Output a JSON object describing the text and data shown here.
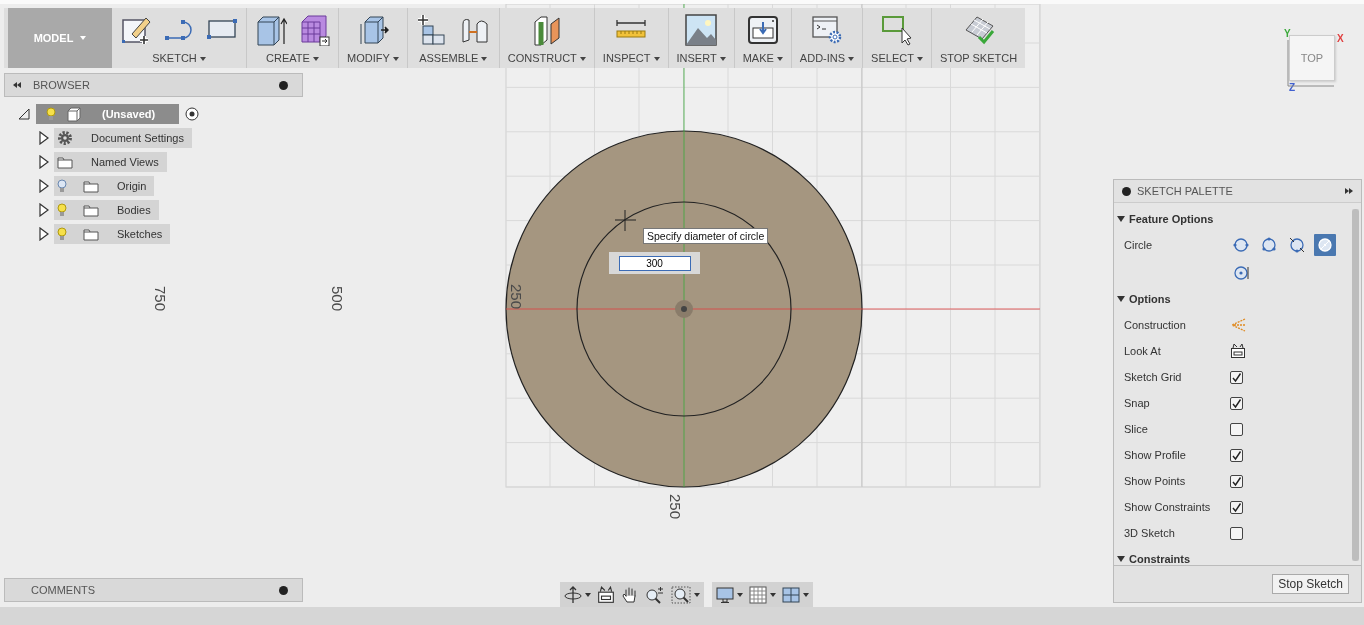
{
  "toolbar": {
    "workspace": {
      "label": "MODEL",
      "dropdown": true
    },
    "groups": [
      {
        "label": "SKETCH",
        "dropdown": true
      },
      {
        "label": "CREATE",
        "dropdown": true
      },
      {
        "label": "MODIFY",
        "dropdown": true
      },
      {
        "label": "ASSEMBLE",
        "dropdown": true
      },
      {
        "label": "CONSTRUCT",
        "dropdown": true
      },
      {
        "label": "INSPECT",
        "dropdown": true
      },
      {
        "label": "INSERT",
        "dropdown": true
      },
      {
        "label": "MAKE",
        "dropdown": true
      },
      {
        "label": "ADD-INS",
        "dropdown": true
      },
      {
        "label": "SELECT",
        "dropdown": true
      },
      {
        "label": "STOP SKETCH",
        "dropdown": false
      }
    ]
  },
  "browser": {
    "title": "BROWSER",
    "root": {
      "label": "(Unsaved)",
      "selected": true,
      "expanded": true,
      "visible": true,
      "children": [
        {
          "kind": "settings",
          "label": "Document Settings",
          "selected": false,
          "expanded": false
        },
        {
          "kind": "views",
          "label": "Named Views",
          "selected": false,
          "expanded": false
        },
        {
          "kind": "folder",
          "label": "Origin",
          "selected": false,
          "expanded": false,
          "visible": false
        },
        {
          "kind": "folder",
          "label": "Bodies",
          "selected": false,
          "expanded": false,
          "visible": true
        },
        {
          "kind": "folder",
          "label": "Sketches",
          "selected": false,
          "expanded": false,
          "visible": true
        }
      ]
    }
  },
  "comments": {
    "title": "COMMENTS"
  },
  "canvas": {
    "dimension_labels": [
      "750",
      "500",
      "250",
      "250"
    ],
    "tooltip": "Specify diameter of circle",
    "diameter_input": {
      "value": "300"
    }
  },
  "view_cube": {
    "face": "TOP",
    "axes": [
      "X",
      "Y",
      "Z"
    ]
  },
  "sketch_palette": {
    "title": "SKETCH PALETTE",
    "sections": [
      {
        "title": "Feature Options",
        "expanded": true,
        "rows": [
          {
            "kind": "tools",
            "label": "Circle",
            "tools": [
              {
                "selected": false
              },
              {
                "selected": false
              },
              {
                "selected": false
              },
              {
                "selected": true
              },
              {
                "selected": false
              }
            ]
          }
        ]
      },
      {
        "title": "Options",
        "expanded": true,
        "rows": [
          {
            "kind": "construction",
            "label": "Construction"
          },
          {
            "kind": "look-at",
            "label": "Look At"
          },
          {
            "kind": "checkbox",
            "label": "Sketch Grid",
            "checked": true
          },
          {
            "kind": "checkbox",
            "label": "Snap",
            "checked": true
          },
          {
            "kind": "checkbox",
            "label": "Slice",
            "checked": false
          },
          {
            "kind": "checkbox",
            "label": "Show Profile",
            "checked": true
          },
          {
            "kind": "checkbox",
            "label": "Show Points",
            "checked": true
          },
          {
            "kind": "checkbox",
            "label": "Show Constraints",
            "checked": true
          },
          {
            "kind": "checkbox",
            "label": "3D Sketch",
            "checked": false
          }
        ]
      },
      {
        "title": "Constraints",
        "expanded": true
      }
    ],
    "button": "Stop Sketch"
  }
}
